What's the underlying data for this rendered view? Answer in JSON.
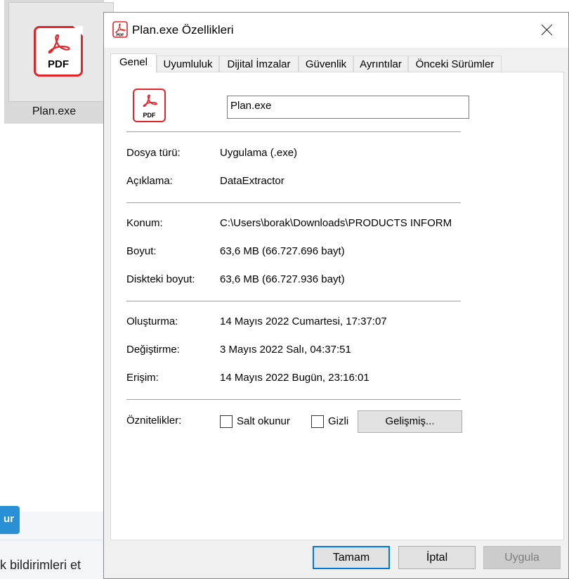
{
  "background": {
    "file_name": "Plan.exe",
    "file_icon_text": "PDF",
    "button_partial": "ur",
    "text_partial": "k bildirimleri et"
  },
  "dialog": {
    "title": "Plan.exe Özellikleri",
    "icon_text": "PDF",
    "tabs": [
      "Genel",
      "Uyumluluk",
      "Dijital İmzalar",
      "Güvenlik",
      "Ayrıntılar",
      "Önceki Sürümler"
    ],
    "active_tab": "Genel",
    "name_value": "Plan.exe",
    "rows": [
      {
        "label": "Dosya türü:",
        "value": "Uygulama (.exe)"
      },
      {
        "label": "Açıklama:",
        "value": "DataExtractor"
      },
      {
        "label": "Konum:",
        "value": "C:\\Users\\borak\\Downloads\\PRODUCTS INFORM"
      },
      {
        "label": "Boyut:",
        "value": "63,6 MB (66.727.696 bayt)"
      },
      {
        "label": "Diskteki boyut:",
        "value": "63,6 MB (66.727.936 bayt)"
      },
      {
        "label": "Oluşturma:",
        "value": "14 Mayıs 2022 Cumartesi, 17:37:07"
      },
      {
        "label": "Değiştirme:",
        "value": "3 Mayıs 2022 Salı, 04:37:51"
      },
      {
        "label": "Erişim:",
        "value": "14 Mayıs 2022 Bugün, 23:16:01"
      }
    ],
    "attributes": {
      "label": "Öznitelikler:",
      "readonly_label": "Salt okunur",
      "readonly_checked": false,
      "hidden_label": "Gizli",
      "hidden_checked": false,
      "advanced_label": "Gelişmiş..."
    },
    "buttons": {
      "ok": "Tamam",
      "cancel": "İptal",
      "apply": "Uygula"
    }
  },
  "colors": {
    "pdf_red": "#e3242b",
    "focus_blue": "#0078d7",
    "bg_button_blue": "#2a90d6"
  }
}
